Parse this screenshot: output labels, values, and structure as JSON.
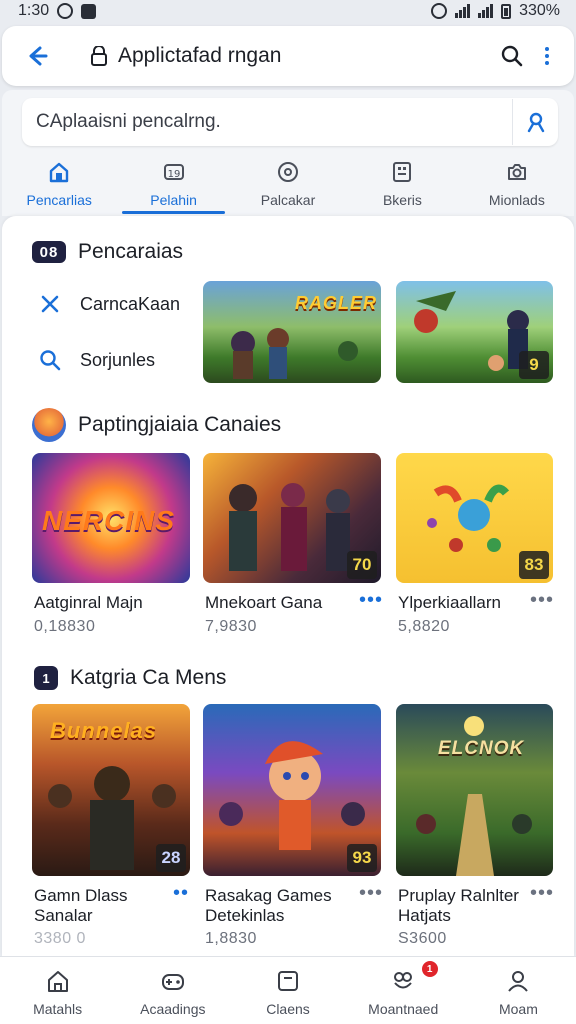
{
  "status_bar": {
    "time": "1:30",
    "battery": "330%"
  },
  "browser": {
    "url_title": "Applictafad rngan"
  },
  "search": {
    "placeholder": "CAplaaisni pencalrng."
  },
  "tabs": [
    {
      "label": "Pencarlias",
      "icon": "home-icon"
    },
    {
      "label": "Pelahin",
      "icon": "game-icon"
    },
    {
      "label": "Palcakar",
      "icon": "controller-icon"
    },
    {
      "label": "Bkeris",
      "icon": "calculator-icon"
    },
    {
      "label": "Mionlads",
      "icon": "camera-icon"
    }
  ],
  "section_search": {
    "badge": "08",
    "title": "Pencaraias",
    "quick_links": [
      {
        "label": "CarncaKaan",
        "icon": "close-icon"
      },
      {
        "label": "Sorjunles",
        "icon": "search-icon"
      }
    ],
    "thumbs": [
      {
        "logo": "RAGLER"
      },
      {
        "num": "9"
      }
    ]
  },
  "section_popular": {
    "title": "Paptingjaiaia Canaies",
    "cards": [
      {
        "title": "Aatginral Majn",
        "meta": "0,18830",
        "logo": "NERCINS"
      },
      {
        "title": "Mnekoart Gana",
        "meta": "7,9830",
        "num": "70"
      },
      {
        "title": "Ylperkiaallarn",
        "meta": "5,8820",
        "num": "83"
      }
    ]
  },
  "section_category": {
    "badge": "1",
    "title": "Katgria Ca Mens",
    "cards": [
      {
        "title": "Gamn Dlass Sanalar",
        "meta": "3380 0",
        "logo": "Bunnelas",
        "num": "28"
      },
      {
        "title": "Rasakag Games Detekinlas",
        "meta": "1,8830",
        "num": "93"
      },
      {
        "title": "Pruplay Ralnlter Hatjats",
        "meta": "S3600",
        "logo": "ELCNOK"
      }
    ]
  },
  "bottom_nav": [
    {
      "label": "Matahls",
      "icon": "home-icon"
    },
    {
      "label": "Acaadings",
      "icon": "gamepad-icon"
    },
    {
      "label": "Claens",
      "icon": "cards-icon"
    },
    {
      "label": "Moantnaed",
      "icon": "puzzle-icon",
      "badge": "1"
    },
    {
      "label": "Moam",
      "icon": "profile-icon"
    }
  ],
  "colors": {
    "accent": "#1a6fd8",
    "notification": "#e0252b"
  }
}
